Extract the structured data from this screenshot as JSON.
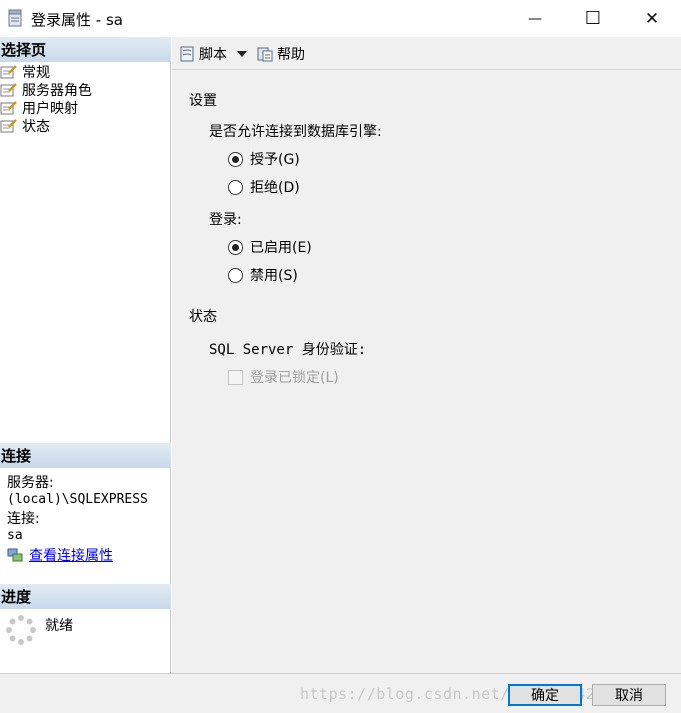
{
  "window": {
    "title": "登录属性 - sa",
    "minimize_glyph": "—",
    "maximize_glyph": "☐",
    "close_glyph": "✕"
  },
  "left": {
    "select_page_header": "选择页",
    "pages": [
      {
        "label": "常规",
        "icon": "page-wrench-icon"
      },
      {
        "label": "服务器角色",
        "icon": "page-wrench-icon"
      },
      {
        "label": "用户映射",
        "icon": "page-wrench-icon"
      },
      {
        "label": "状态",
        "icon": "page-wrench-icon"
      }
    ],
    "connection_header": "连接",
    "server_label": "服务器:",
    "server_value": "(local)\\SQLEXPRESS",
    "connection_label": "连接:",
    "connection_value": "sa",
    "view_props_link": "查看连接属性",
    "progress_header": "进度",
    "progress_status": "就绪"
  },
  "toolbar": {
    "script_label": "脚本",
    "help_label": "帮助"
  },
  "settings": {
    "section_title": "设置",
    "allow_question": "是否允许连接到数据库引擎:",
    "grant_label": "授予(G)",
    "deny_label": "拒绝(D)",
    "allow_selected": "grant",
    "login_label": "登录:",
    "enabled_label": "已启用(E)",
    "disabled_label": "禁用(S)",
    "login_selected": "enabled"
  },
  "status": {
    "section_title": "状态",
    "auth_label": "SQL Server 身份验证:",
    "locked_label": "登录已锁定(L)",
    "locked_checked": false,
    "locked_enabled": false
  },
  "footer": {
    "ok_label": "确定",
    "cancel_label": "取消",
    "watermark": "https://blog.csdn.net/weixin_42504109"
  }
}
